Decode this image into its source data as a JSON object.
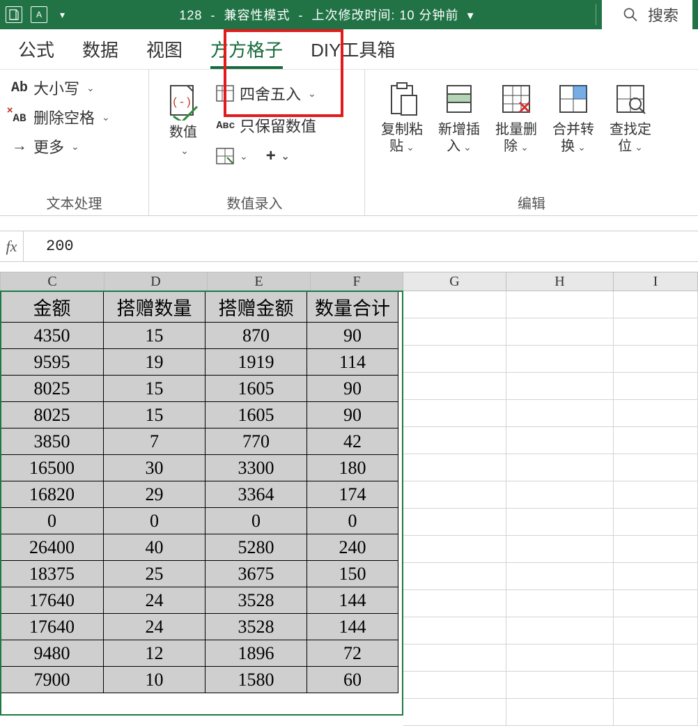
{
  "titlebar": {
    "doc_num": "128",
    "sep": "-",
    "mode": "兼容性模式",
    "last_mod_label": "上次修改时间:",
    "last_mod_value": "10 分钟前",
    "chev": "▾",
    "search_placeholder": "搜索"
  },
  "tabs": {
    "formula": "公式",
    "data": "数据",
    "view": "视图",
    "ffgz": "方方格子",
    "diy": "DIY工具箱"
  },
  "ribbon": {
    "group1_label": "文本处理",
    "case_label": "大小写",
    "delspace_label": "删除空格",
    "more_label": "更多",
    "case_icon": "Ab",
    "delspace_icon": "AB",
    "more_icon": "→",
    "group2_mid_label": "数值录入",
    "numval_label": "数值",
    "round_label": "四舍五入",
    "keepnum_label": "只保留数值",
    "keepnum_icon": "Aʙᴄ",
    "group3_label": "编辑",
    "copy_paste": "复制粘贴",
    "new_insert": "新增插入",
    "batch_delete": "批量删除",
    "merge_convert": "合并转换",
    "find_locate": "查找定位"
  },
  "formula_bar": {
    "fx": "fx",
    "value": "200"
  },
  "columns": {
    "C": "C",
    "D": "D",
    "E": "E",
    "F": "F",
    "G": "G",
    "H": "H",
    "I": "I"
  },
  "col_widths": {
    "C": 150,
    "D": 148,
    "E": 148,
    "F": 133,
    "G": 148,
    "H": 154,
    "I": 121
  },
  "table": {
    "headers": {
      "C": "金额",
      "D": "搭赠数量",
      "E": "搭赠金额",
      "F": "数量合计"
    },
    "rows": [
      {
        "C": "4350",
        "D": "15",
        "E": "870",
        "F": "90"
      },
      {
        "C": "9595",
        "D": "19",
        "E": "1919",
        "F": "114"
      },
      {
        "C": "8025",
        "D": "15",
        "E": "1605",
        "F": "90"
      },
      {
        "C": "8025",
        "D": "15",
        "E": "1605",
        "F": "90"
      },
      {
        "C": "3850",
        "D": "7",
        "E": "770",
        "F": "42"
      },
      {
        "C": "16500",
        "D": "30",
        "E": "3300",
        "F": "180"
      },
      {
        "C": "16820",
        "D": "29",
        "E": "3364",
        "F": "174"
      },
      {
        "C": "0",
        "D": "0",
        "E": "0",
        "F": "0"
      },
      {
        "C": "26400",
        "D": "40",
        "E": "5280",
        "F": "240"
      },
      {
        "C": "18375",
        "D": "25",
        "E": "3675",
        "F": "150"
      },
      {
        "C": "17640",
        "D": "24",
        "E": "3528",
        "F": "144"
      },
      {
        "C": "17640",
        "D": "24",
        "E": "3528",
        "F": "144"
      },
      {
        "C": "9480",
        "D": "12",
        "E": "1896",
        "F": "72"
      },
      {
        "C": "7900",
        "D": "10",
        "E": "1580",
        "F": "60"
      }
    ]
  }
}
